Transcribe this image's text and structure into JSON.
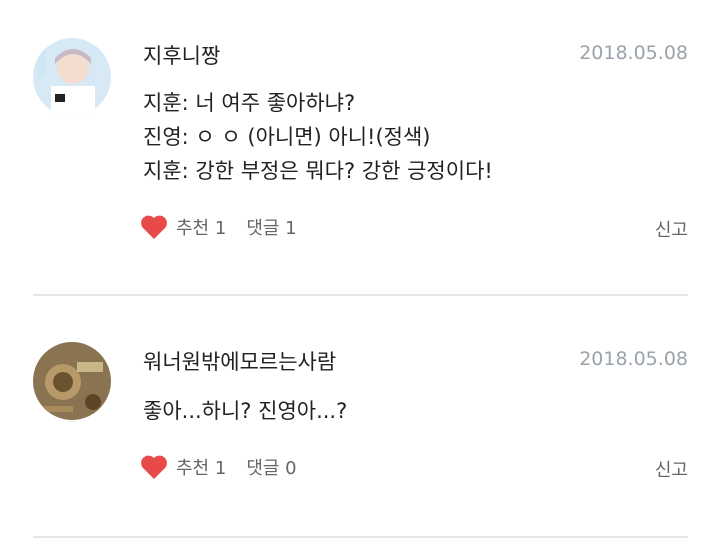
{
  "comments": [
    {
      "author": "지후니짱",
      "date": "2018.05.08",
      "lines": [
        "지훈: 너 여주 좋아하냐?",
        "진영: ㅇ ㅇ (아니면) 아니!(정색)",
        "지훈: 강한 부정은 뭐다? 강한 긍정이다!"
      ],
      "like_label": "추천",
      "like_count": "1",
      "reply_label": "댓글",
      "reply_count": "1",
      "report_label": "신고"
    },
    {
      "author": "워너원밖에모르는사람",
      "date": "2018.05.08",
      "lines": [
        "좋아...하니? 진영아...?"
      ],
      "like_label": "추천",
      "like_count": "1",
      "reply_label": "댓글",
      "reply_count": "0",
      "report_label": "신고"
    }
  ],
  "colors": {
    "heart": "#e84a4a",
    "date": "#9aa3ab",
    "divider": "#e4e7ea"
  },
  "icons": {
    "like": "heart-icon",
    "avatar1": "avatar-photo",
    "avatar2": "avatar-photo"
  }
}
